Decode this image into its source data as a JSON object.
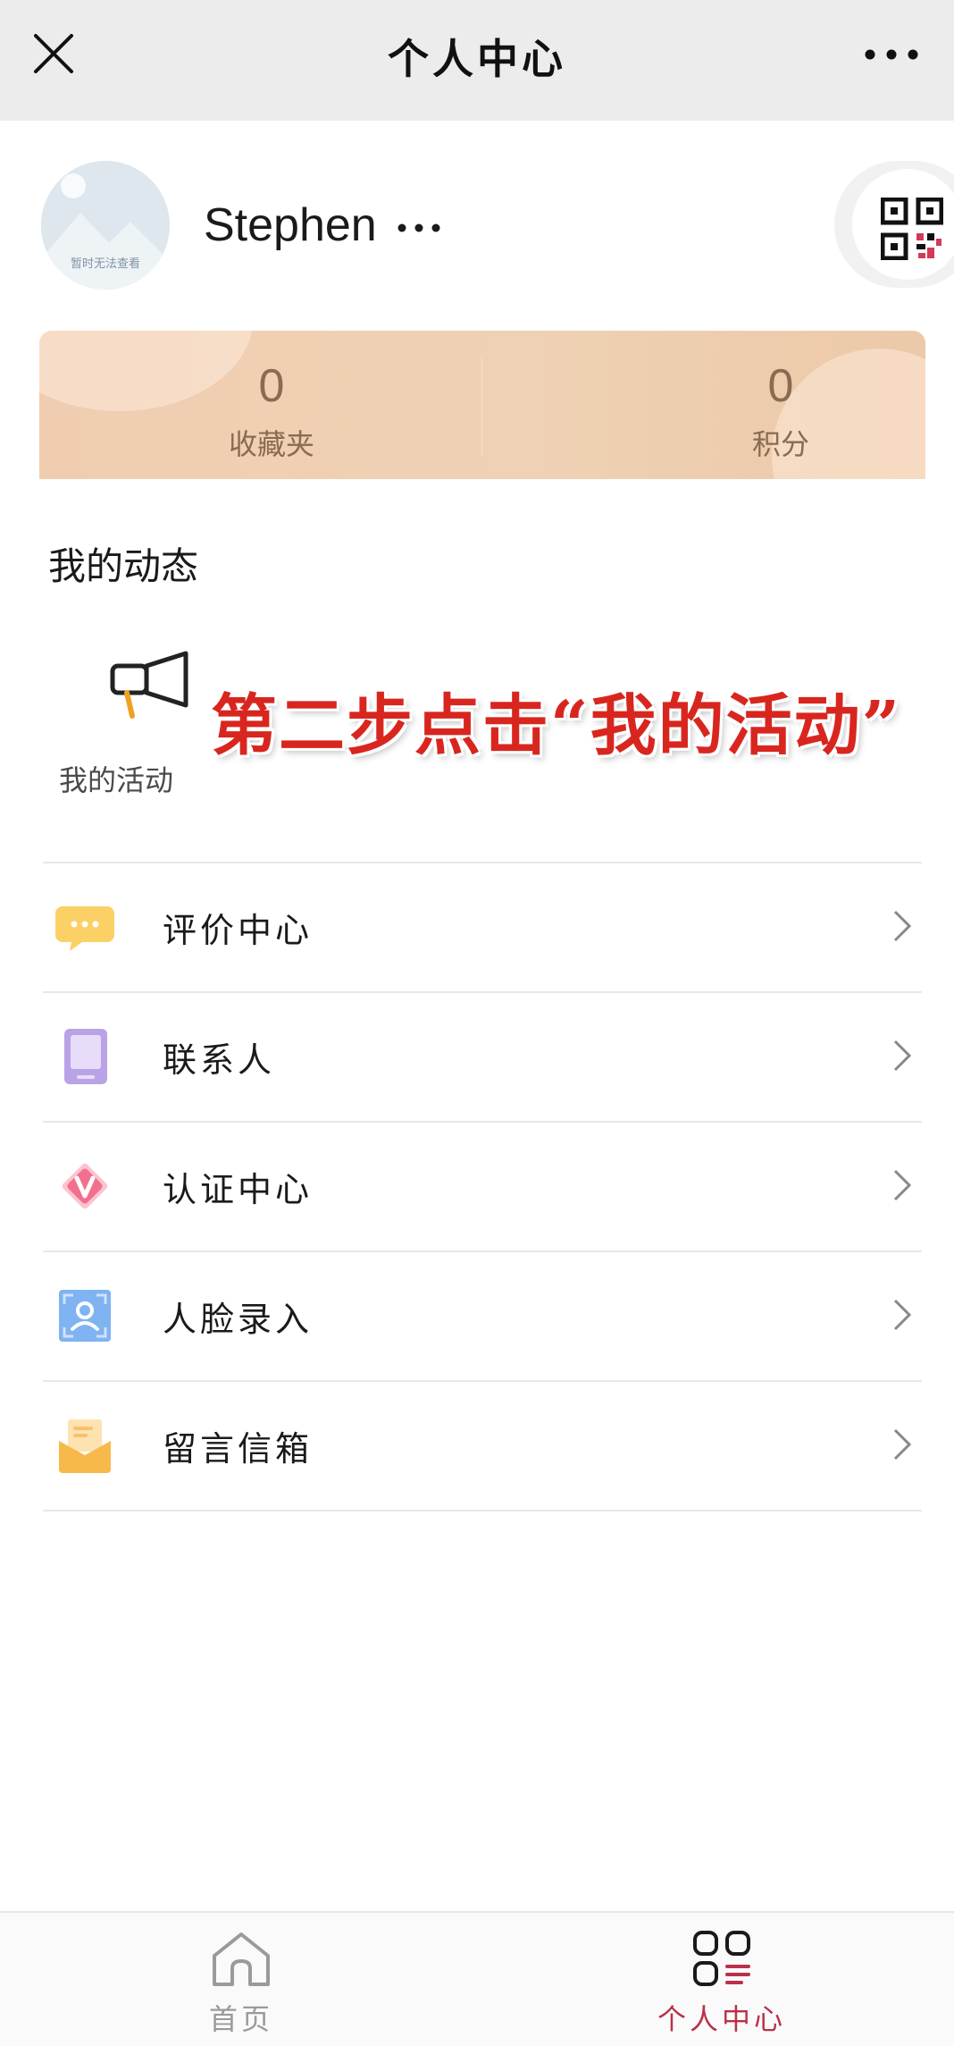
{
  "header": {
    "title": "个人中心",
    "close_icon": "close-icon",
    "more_icon": "more-horizontal-icon"
  },
  "profile": {
    "avatar_placeholder_text": "暂时无法查看",
    "username": "Stephen",
    "qr_icon": "qr-code-icon"
  },
  "stats": [
    {
      "value": "0",
      "label": "收藏夹"
    },
    {
      "value": "0",
      "label": "积分"
    }
  ],
  "dynamics": {
    "title": "我的动态",
    "items": [
      {
        "label": "我的活动",
        "icon": "megaphone-icon"
      }
    ]
  },
  "annotation": "第二步点击“我的活动”",
  "menu": [
    {
      "label": "评价中心",
      "icon": "chat-bubble-icon"
    },
    {
      "label": "联系人",
      "icon": "contact-book-icon"
    },
    {
      "label": "认证中心",
      "icon": "verified-v-icon"
    },
    {
      "label": "人脸录入",
      "icon": "face-scan-icon"
    },
    {
      "label": "留言信箱",
      "icon": "mail-envelope-icon"
    }
  ],
  "tabbar": [
    {
      "label": "首页",
      "icon": "home-icon",
      "active": false
    },
    {
      "label": "个人中心",
      "icon": "personal-center-icon",
      "active": true
    }
  ],
  "colors": {
    "accent": "#b8324a",
    "annotation": "#d8261f",
    "stats_text": "#8a6b52",
    "stats_card": "#efd1b5"
  }
}
